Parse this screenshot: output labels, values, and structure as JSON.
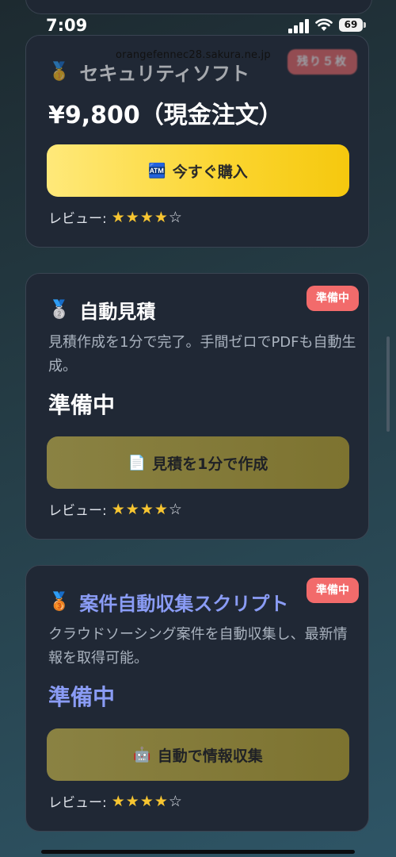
{
  "status_bar": {
    "time": "7:09",
    "battery": "69"
  },
  "url": "orangefennec28.sakura.ne.jp",
  "colors": {
    "accent_link": "#8a9cf5",
    "badge": "#f26b6b",
    "primary_btn": "#fbd52f",
    "muted_btn": "#857b3a"
  },
  "cards": [
    {
      "medal_icon": "gold-medal-icon",
      "medal": "🥇",
      "title": "セキュリティソフト",
      "badge": "残り５枚",
      "price": "¥9,800（現金注文）",
      "button": {
        "icon": "🏧",
        "icon_name": "atm-icon",
        "label": "今すぐ購入"
      },
      "review_label": "レビュー:",
      "rating": 4,
      "rating_max": 5
    },
    {
      "medal_icon": "silver-medal-icon",
      "medal": "🥈",
      "title": "自動見積",
      "badge": "準備中",
      "description": "見積作成を1分で完了。手間ゼロでPDFも自動生成。",
      "status": "準備中",
      "button": {
        "icon": "📄",
        "icon_name": "document-icon",
        "label": "見積を1分で作成"
      },
      "review_label": "レビュー:",
      "rating": 4,
      "rating_max": 5
    },
    {
      "medal_icon": "bronze-medal-icon",
      "medal": "🥉",
      "title": "案件自動収集スクリプト",
      "badge": "準備中",
      "description": "クラウドソーシング案件を自動収集し、最新情報を取得可能。",
      "status": "準備中",
      "button": {
        "icon": "🤖",
        "icon_name": "robot-icon",
        "label": "自動で情報収集"
      },
      "review_label": "レビュー:",
      "rating": 4,
      "rating_max": 5
    }
  ]
}
